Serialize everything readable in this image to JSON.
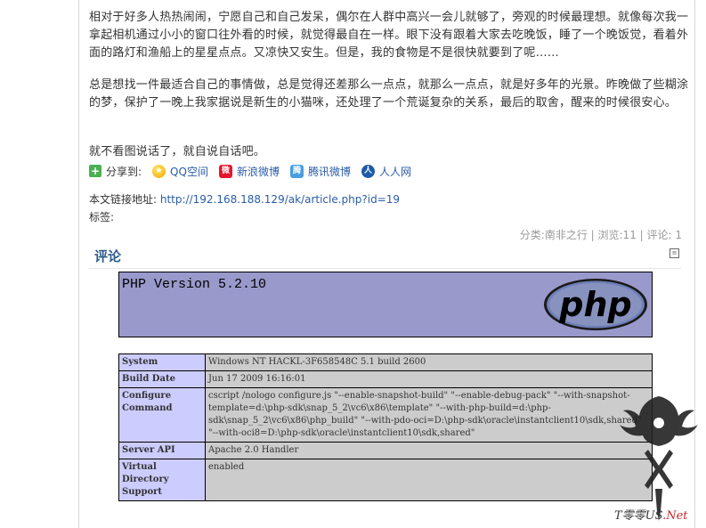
{
  "article": {
    "paragraph1": "相对于好多人热热闹闹，宁愿自己和自己发呆，偶尔在人群中高兴一会儿就够了，旁观的时候最理想。就像每次我一拿起相机通过小小的窗口往外看的时候，就觉得最自在一样。眼下没有跟着大家去吃晚饭，睡了一个晚饭觉，看着外面的路灯和渔船上的星星点点。又凉快又安生。但是，我的食物是不是很快就要到了呢……",
    "paragraph2": "总是想找一件最适合自己的事情做，总是觉得还差那么一点点，就那么一点点，就是好多年的光景。昨晚做了些糊涂的梦，保护了一晚上我家据说是新生的小猫咪，还处理了一个荒诞复杂的关系，最后的取舍，醒来的时候很安心。",
    "paragraph3": "就不看图说话了，就自说自话吧。"
  },
  "share": {
    "label": "分享到:",
    "items": [
      {
        "label": "QQ空间",
        "icon": "qzone-icon"
      },
      {
        "label": "新浪微博",
        "icon": "weibo-icon"
      },
      {
        "label": "腾讯微博",
        "icon": "tencent-weibo-icon"
      },
      {
        "label": "人人网",
        "icon": "renren-icon"
      }
    ]
  },
  "permalink": {
    "label": "本文链接地址:",
    "url": "http://192.168.188.129/ak/article.php?id=19"
  },
  "tags": {
    "label": "标签:"
  },
  "meta": {
    "text": "分类:南非之行 | 浏览:11 | 评论: 1"
  },
  "comments": {
    "title": "评论",
    "menu_icon": "menu-icon"
  },
  "phpinfo": {
    "version": "PHP Version 5.2.10",
    "logo_text": "php",
    "rows": [
      {
        "key": "System",
        "value": "Windows NT HACKL-3F658548C 5.1 build 2600"
      },
      {
        "key": "Build Date",
        "value": "Jun 17 2009 16:16:01"
      },
      {
        "key": "Configure Command",
        "value": "cscript /nologo configure.js \"--enable-snapshot-build\" \"--enable-debug-pack\" \"--with-snapshot-template=d:\\php-sdk\\snap_5_2\\vc6\\x86\\template\" \"--with-php-build=d:\\php-sdk\\snap_5_2\\vc6\\x86\\php_build\" \"--with-pdo-oci=D:\\php-sdk\\oracle\\instantclient10\\sdk,shared\" \"--with-oci8=D:\\php-sdk\\oracle\\instantclient10\\sdk,shared\""
      },
      {
        "key": "Server API",
        "value": "Apache 2.0 Handler"
      },
      {
        "key": "Virtual Directory Support",
        "value": "enabled"
      }
    ]
  },
  "watermark": {
    "text_main": "T零零US",
    "text_net": ".Net"
  },
  "colors": {
    "link": "#2a5caa",
    "php_header": "#9999cc",
    "php_key": "#ccccff",
    "php_value": "#cccccc",
    "comment_title": "#2d5a8b"
  }
}
